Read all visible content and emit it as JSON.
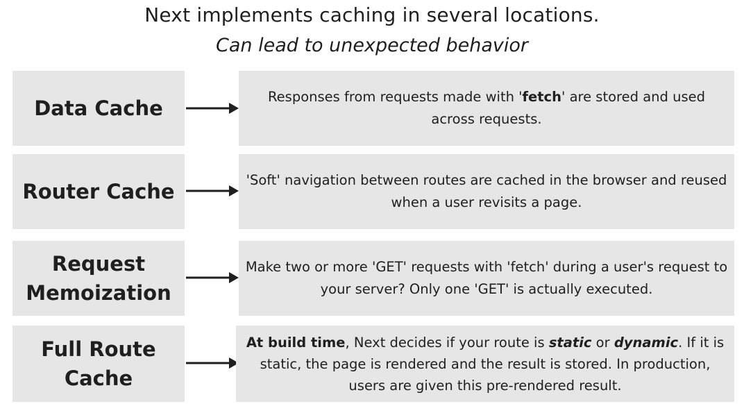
{
  "title": "Next implements caching in several locations.",
  "subtitle": "Can lead to unexpected behavior",
  "rows": [
    {
      "label": "Data Cache",
      "description": {
        "part1": "Responses from requests made with '",
        "bold": "fetch",
        "part2": "' are stored and used across requests."
      }
    },
    {
      "label": "Router Cache",
      "description": {
        "text": "'Soft' navigation between routes are cached in the browser and reused when a user revisits a page."
      }
    },
    {
      "label": "Request Memoization",
      "description": {
        "text": "Make two or more 'GET' requests with 'fetch' during a user's request to your server? Only one 'GET' is actually executed."
      }
    },
    {
      "label": "Full Route Cache",
      "description": {
        "bold_lead": "At build time",
        "part1": ", Next decides if your route is ",
        "static": "static",
        "part2": " or ",
        "dynamic": "dynamic",
        "part3": ". If it is static, the page is rendered and the result is stored. In production, users are given this pre-rendered result."
      }
    }
  ],
  "colors": {
    "box_background": "#e6e6e6",
    "text": "#1f1f1f",
    "arrow": "#1f1f1f"
  }
}
